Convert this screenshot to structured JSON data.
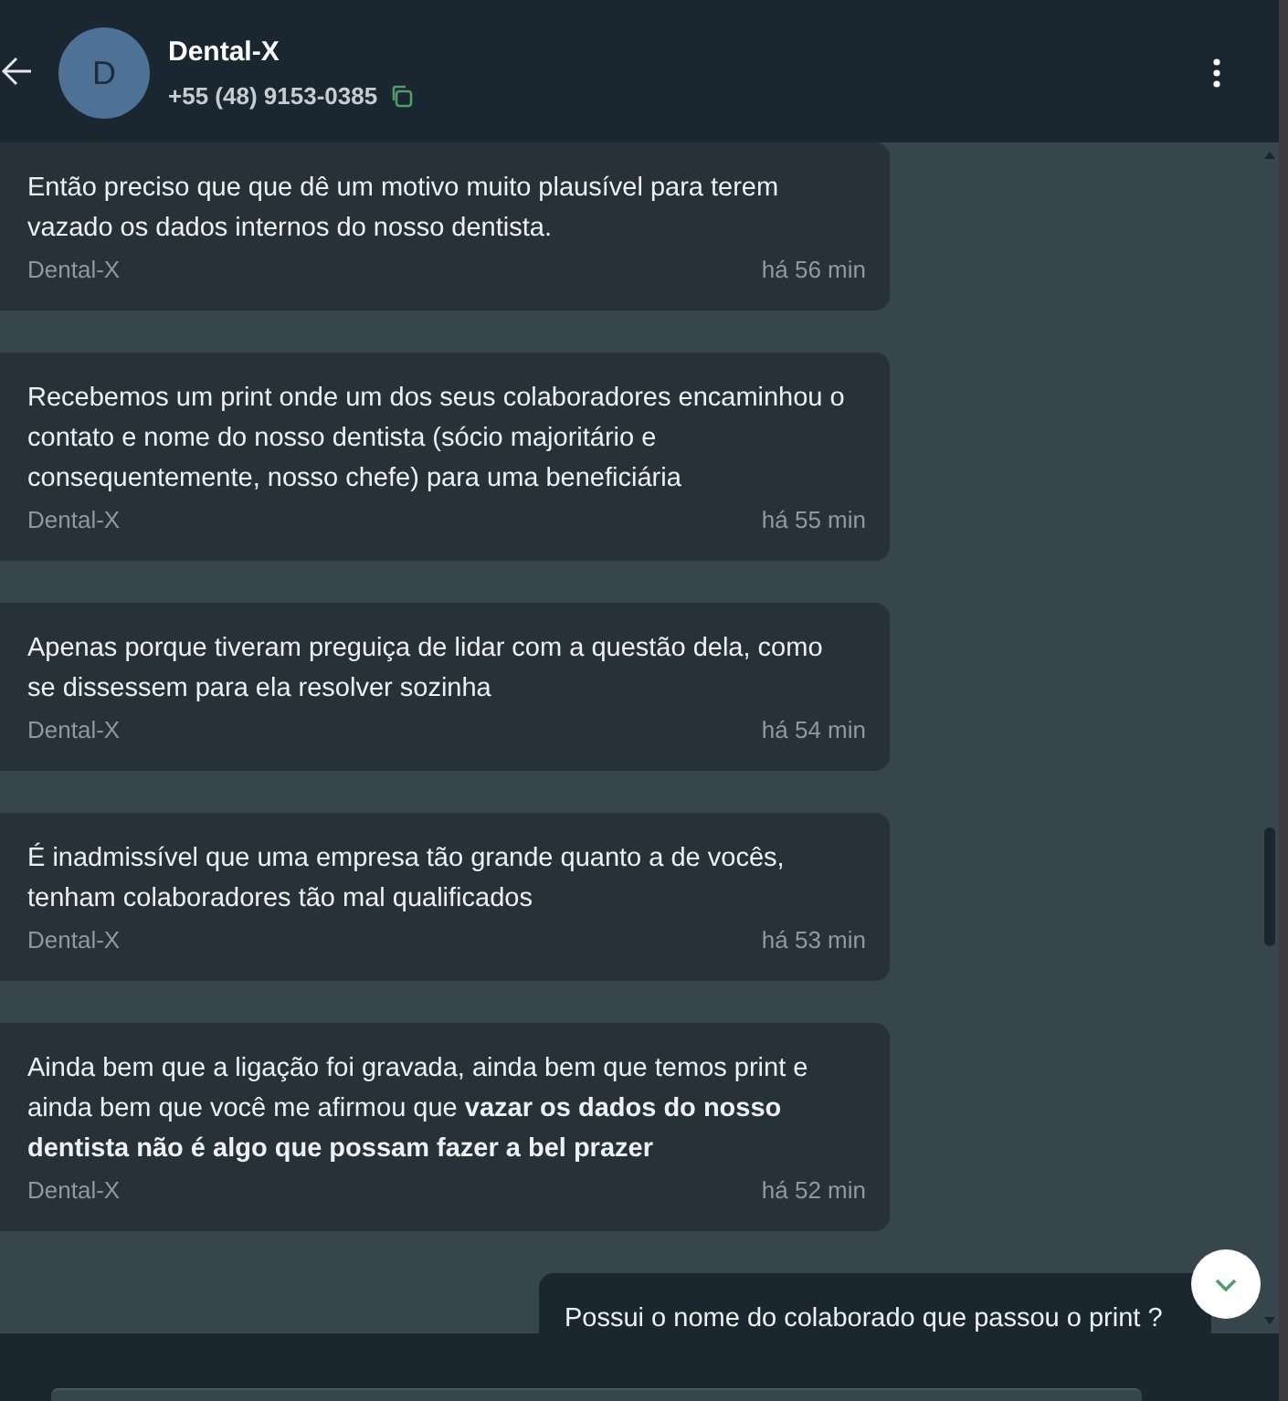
{
  "header": {
    "avatar_letter": "D",
    "name": "Dental-X",
    "phone": "+55 (48) 9153-0385"
  },
  "messages": [
    {
      "kind": "incoming",
      "text": "Então preciso que que dê um motivo muito plausível para terem vazado os dados internos do nosso dentista.",
      "sender": "Dental-X",
      "time": "há 56 min"
    },
    {
      "kind": "incoming",
      "text": "Recebemos um print onde um dos seus colaboradores encaminhou o contato e nome do nosso dentista (sócio majoritário e consequentemente, nosso chefe) para uma beneficiária",
      "sender": "Dental-X",
      "time": "há 55 min"
    },
    {
      "kind": "incoming",
      "text": "Apenas porque tiveram preguiça de lidar com a questão dela, como se dissessem para ela resolver sozinha",
      "sender": "Dental-X",
      "time": "há 54 min"
    },
    {
      "kind": "incoming",
      "text": "É inadmissível que uma empresa tão grande quanto a de vocês, tenham colaboradores tão mal qualificados",
      "sender": "Dental-X",
      "time": "há 53 min"
    },
    {
      "kind": "incoming",
      "text": "Ainda bem que a ligação foi gravada, ainda bem que temos print e ainda bem que você me afirmou que **vazar os dados do nosso dentista não é algo que possam fazer a bel prazer**",
      "sender": "Dental-X",
      "time": "há 52 min"
    },
    {
      "kind": "outgoing",
      "text": "Possui o nome do colaborado que passou o print ?"
    }
  ]
}
